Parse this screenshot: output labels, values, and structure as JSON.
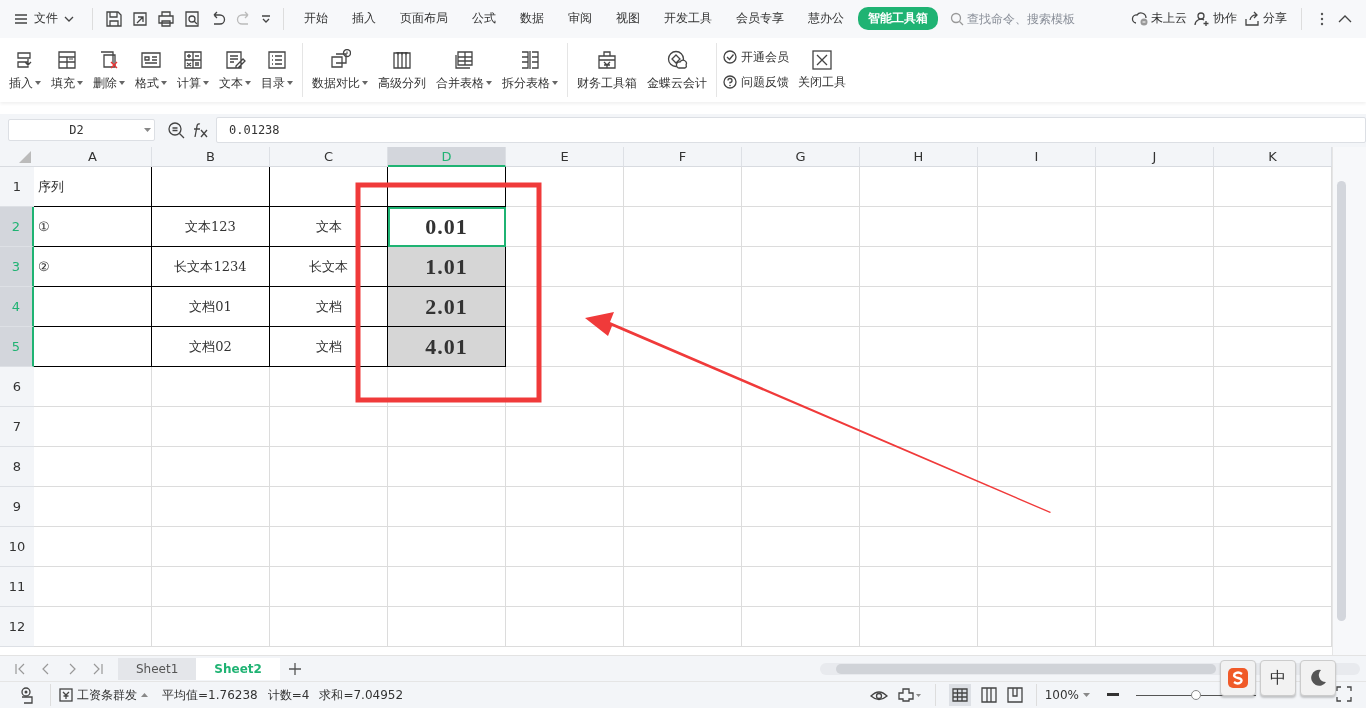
{
  "title_bar": {
    "file_menu": "文件",
    "tabs": [
      {
        "label": "开始",
        "selected": false
      },
      {
        "label": "插入",
        "selected": false
      },
      {
        "label": "页面布局",
        "selected": false
      },
      {
        "label": "公式",
        "selected": false
      },
      {
        "label": "数据",
        "selected": false
      },
      {
        "label": "审阅",
        "selected": false
      },
      {
        "label": "视图",
        "selected": false
      },
      {
        "label": "开发工具",
        "selected": false
      },
      {
        "label": "会员专享",
        "selected": false
      },
      {
        "label": "慧办公",
        "selected": false
      },
      {
        "label": "智能工具箱",
        "selected": true
      }
    ],
    "search": {
      "placeholder": "查找命令、搜索模板"
    },
    "actions": [
      "未上云",
      "协作",
      "分享"
    ]
  },
  "ribbon": {
    "groups": [
      {
        "tools": [
          {
            "label": "插入",
            "dropdown": true
          },
          {
            "label": "填充",
            "dropdown": true
          },
          {
            "label": "删除",
            "dropdown": true
          },
          {
            "label": "格式",
            "dropdown": true
          },
          {
            "label": "计算",
            "dropdown": true
          },
          {
            "label": "文本",
            "dropdown": true
          },
          {
            "label": "目录",
            "dropdown": true
          }
        ]
      },
      {
        "tools": [
          {
            "label": "数据对比",
            "dropdown": true
          },
          {
            "label": "高级分列",
            "dropdown": false
          },
          {
            "label": "合并表格",
            "dropdown": true
          },
          {
            "label": "拆分表格",
            "dropdown": true
          }
        ]
      },
      {
        "tools": [
          {
            "label": "财务工具箱",
            "dropdown": false
          },
          {
            "label": "金蝶云会计",
            "dropdown": false
          }
        ]
      }
    ],
    "small_tools": [
      "开通会员",
      "问题反馈"
    ],
    "close_tool": "关闭工具"
  },
  "formula_bar": {
    "name_box": "D2",
    "formula": "0.01238"
  },
  "sheet": {
    "columns": [
      {
        "label": "A",
        "selected": false
      },
      {
        "label": "B",
        "selected": false
      },
      {
        "label": "C",
        "selected": false
      },
      {
        "label": "D",
        "selected": true
      },
      {
        "label": "E",
        "selected": false
      },
      {
        "label": "F",
        "selected": false
      },
      {
        "label": "G",
        "selected": false
      },
      {
        "label": "H",
        "selected": false
      },
      {
        "label": "I",
        "selected": false
      },
      {
        "label": "J",
        "selected": false
      },
      {
        "label": "K",
        "selected": false
      }
    ],
    "rows": [
      {
        "number": "1",
        "selected": false,
        "cells": [
          "序列",
          null,
          null,
          null
        ]
      },
      {
        "number": "2",
        "selected": true,
        "cells": [
          "①",
          "文本123",
          "文本",
          "0.01"
        ]
      },
      {
        "number": "3",
        "selected": true,
        "cells": [
          "②",
          "长文本1234",
          "长文本",
          "1.01"
        ]
      },
      {
        "number": "4",
        "selected": true,
        "cells": [
          null,
          "文档01",
          "文档",
          "2.01"
        ]
      },
      {
        "number": "5",
        "selected": true,
        "cells": [
          null,
          "文档02",
          "文档",
          "4.01"
        ]
      },
      {
        "number": "6",
        "selected": false,
        "cells": []
      },
      {
        "number": "7",
        "selected": false,
        "cells": []
      },
      {
        "number": "8",
        "selected": false,
        "cells": []
      },
      {
        "number": "9",
        "selected": false,
        "cells": []
      },
      {
        "number": "10",
        "selected": false,
        "cells": []
      },
      {
        "number": "11",
        "selected": false,
        "cells": []
      },
      {
        "number": "12",
        "selected": false,
        "cells": []
      }
    ]
  },
  "sheet_tabs": [
    {
      "label": "Sheet1",
      "selected": false
    },
    {
      "label": "Sheet2",
      "selected": true
    }
  ],
  "status_bar": {
    "tool": "工资条群发",
    "average": "平均值=1.76238",
    "count": "计数=4",
    "sum": "求和=7.04952",
    "zoom": "100%",
    "zoom_slider": {
      "level": 0.5
    }
  },
  "ime_toolbar": {
    "mode": "中"
  }
}
